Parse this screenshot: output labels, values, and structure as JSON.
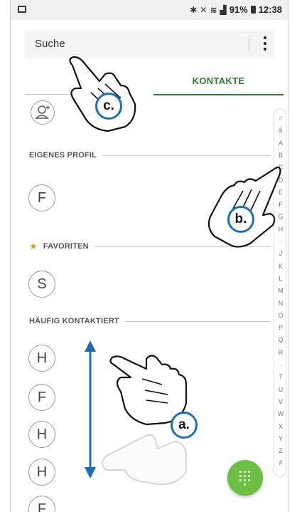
{
  "status_bar": {
    "battery_percent": "91%",
    "time": "12:38",
    "icons": [
      "bluetooth-icon",
      "mute-icon",
      "wifi-icon",
      "signal-icon",
      "battery-icon"
    ]
  },
  "search": {
    "placeholder": "Suche"
  },
  "tabs": {
    "active_label": "KONTAKTE"
  },
  "sections": {
    "own_profile": {
      "title": "EIGENES PROFIL",
      "avatar_letter": "F"
    },
    "favorites": {
      "title": "FAVORITEN",
      "avatar_letter": "S"
    },
    "frequent": {
      "title": "HÄUFIG KONTAKTIERT",
      "avatar_letters": [
        "H",
        "F",
        "H",
        "H",
        "F"
      ]
    }
  },
  "index_letters": [
    "☆",
    "&",
    "A",
    "B",
    "C",
    "D",
    "E",
    "F",
    "G",
    "H",
    "·",
    "J",
    "K",
    "L",
    "M",
    "N",
    "O",
    "P",
    "Q",
    "R",
    "·",
    "T",
    "U",
    "V",
    "W",
    "X",
    "Y",
    "Z",
    "#"
  ],
  "annotations": {
    "a": "a.",
    "b": "b.",
    "c": "c."
  },
  "colors": {
    "accent_green": "#2e7d32",
    "fab_green": "#6cbe45",
    "callout_blue": "#1a6fb8",
    "arrow_blue": "#1a6fb8",
    "star_orange": "#e69a1e"
  }
}
